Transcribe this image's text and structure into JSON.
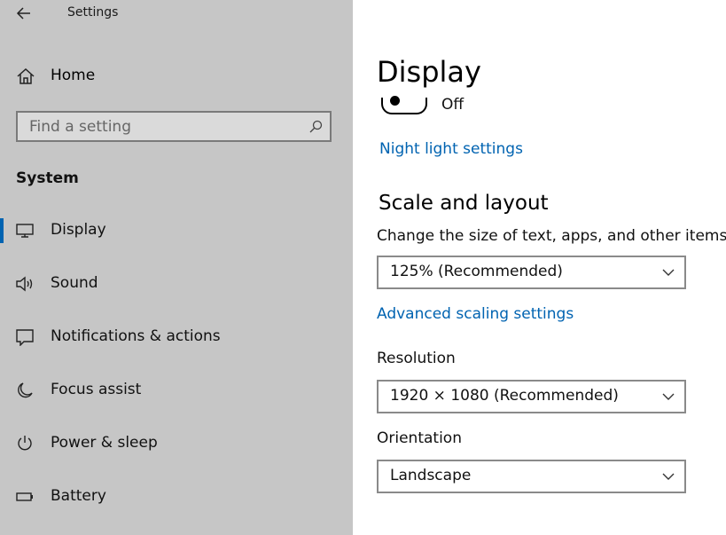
{
  "window": {
    "title": "Settings"
  },
  "sidebar": {
    "home_label": "Home",
    "search": {
      "placeholder": "Find a setting",
      "value": ""
    },
    "section_label": "System",
    "items": [
      {
        "label": "Display",
        "icon": "monitor-icon",
        "active": true
      },
      {
        "label": "Sound",
        "icon": "speaker-icon"
      },
      {
        "label": "Notifications & actions",
        "icon": "notification-icon"
      },
      {
        "label": "Focus assist",
        "icon": "moon-icon"
      },
      {
        "label": "Power & sleep",
        "icon": "power-icon"
      },
      {
        "label": "Battery",
        "icon": "battery-icon"
      }
    ]
  },
  "main": {
    "title": "Display",
    "night_light": {
      "state": "Off",
      "on": false,
      "link": "Night light settings"
    },
    "scale_layout": {
      "heading": "Scale and layout",
      "description": "Change the size of text, apps, and other items",
      "scale_value": "125% (Recommended)",
      "advanced_link": "Advanced scaling settings",
      "resolution_label": "Resolution",
      "resolution_value": "1920 × 1080 (Recommended)",
      "orientation_label": "Orientation",
      "orientation_value": "Landscape"
    }
  },
  "colors": {
    "accent": "#0063b1",
    "sidebar_bg": "#c6c6c6"
  }
}
